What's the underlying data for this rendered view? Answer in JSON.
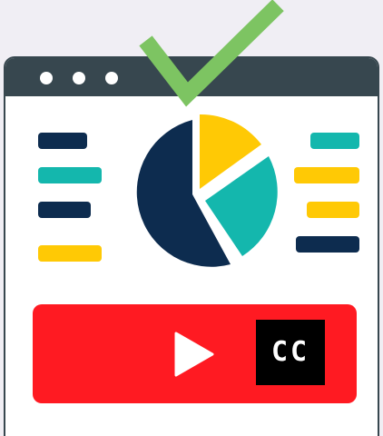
{
  "colors": {
    "background": "#f0eef4",
    "window_frame": "#37474f",
    "navy": "#0d2c4f",
    "teal": "#14b7ad",
    "yellow": "#ffc905",
    "red": "#ff1a22",
    "check_green": "#7dc462"
  },
  "window": {
    "titlebar_dots": [
      "dot",
      "dot",
      "dot"
    ]
  },
  "icons": {
    "checkmark": "checkmark-icon",
    "pie_chart": "pie-chart-icon",
    "play": "play-icon",
    "closed_captions": "closed-captions-icon"
  },
  "legend_left": [
    "navy",
    "teal",
    "navy",
    "yellow"
  ],
  "legend_right": [
    "teal",
    "yellow",
    "yellow",
    "navy"
  ],
  "player": {
    "cc_label": "CC"
  }
}
